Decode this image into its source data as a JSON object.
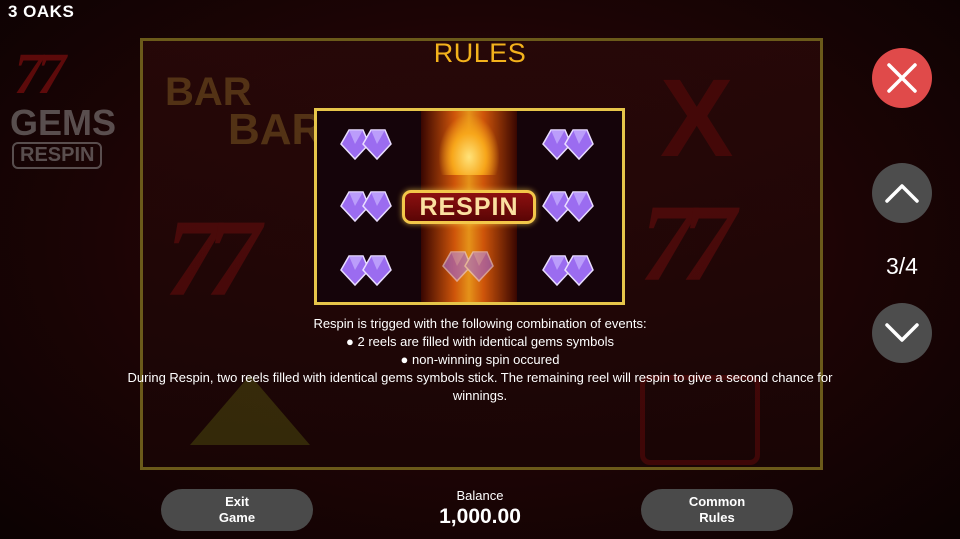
{
  "brand": "3 OAKS",
  "background": {
    "logo_line1": "77",
    "logo_line2": "GEMS",
    "logo_line3": "RESPIN",
    "bar_text": "BAR",
    "bar_text2": "BAR",
    "seven_left": "77",
    "seven_right": "77",
    "x_symbol": "X"
  },
  "rules": {
    "title": "RULES",
    "badge_text": "RESPIN",
    "description": [
      "Respin is trigged with the following combination of events:",
      "● 2 reels are filled with identical gems symbols",
      "● non-winning spin occured",
      "During Respin, two reels filled with identical gems symbols stick. The remaining reel will respin to give a second chance for winnings."
    ]
  },
  "pagination": {
    "current": "3/4"
  },
  "footer": {
    "exit_line1": "Exit",
    "exit_line2": "Game",
    "balance_label": "Balance",
    "balance_value": "1,000.00",
    "common_line1": "Common",
    "common_line2": "Rules"
  },
  "icons": {
    "close": "close-icon",
    "up": "chevron-up-icon",
    "down": "chevron-down-icon",
    "gem": "purple-gem-icon"
  },
  "colors": {
    "title": "#f3b21c",
    "close_button": "#e04a4a",
    "nav_button": "#4d4d4d",
    "preview_border": "#e6c54a",
    "gem": "#9b6cf0"
  }
}
